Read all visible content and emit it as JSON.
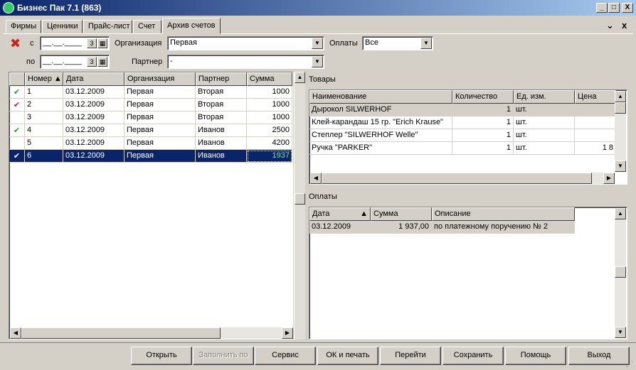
{
  "window": {
    "title": "Бизнес Пак 7.1 (863)",
    "min": "_",
    "max": "□",
    "close": "X",
    "menu_close": "x"
  },
  "tabs": [
    "Фирмы",
    "Ценники",
    "Прайс-лист",
    "Счет",
    "Архив счетов"
  ],
  "filters": {
    "from_label": "с",
    "to_label": "по",
    "date_placeholder": "__.__.____",
    "org_label": "Организация",
    "org_value": "Первая",
    "partner_label": "Партнер",
    "partner_value": "-",
    "payments_label": "Оплаты",
    "payments_value": "Все"
  },
  "invoices": {
    "columns": [
      "Номер",
      "Дата",
      "Организация",
      "Партнер",
      "Сумма"
    ],
    "rows": [
      {
        "mark": "✔",
        "mark_color": "green",
        "num": "1",
        "date": "03.12.2009",
        "org": "Первая",
        "partner": "Вторая",
        "sum": "1000"
      },
      {
        "mark": "✔",
        "mark_color": "red",
        "num": "2",
        "date": "03.12.2009",
        "org": "Первая",
        "partner": "Вторая",
        "sum": "1000"
      },
      {
        "mark": "",
        "mark_color": "",
        "num": "3",
        "date": "03.12.2009",
        "org": "Первая",
        "partner": "Вторая",
        "sum": "1000"
      },
      {
        "mark": "✔",
        "mark_color": "green",
        "num": "4",
        "date": "03.12.2009",
        "org": "Первая",
        "partner": "Иванов",
        "sum": "2500"
      },
      {
        "mark": "",
        "mark_color": "",
        "num": "5",
        "date": "03.12.2009",
        "org": "Первая",
        "partner": "Иванов",
        "sum": "4200"
      },
      {
        "mark": "✔",
        "mark_color": "green",
        "num": "6",
        "date": "03.12.2009",
        "org": "Первая",
        "partner": "Иванов",
        "sum": "1937"
      }
    ]
  },
  "goods": {
    "label": "Товары",
    "columns": [
      "Наименование",
      "Количество",
      "Ед. изм.",
      "Цена"
    ],
    "rows": [
      {
        "name": "Дырокол SILWERHOF",
        "qty": "1",
        "unit": "шт.",
        "price": ""
      },
      {
        "name": "Клей-карандаш 15 гр. \"Erich Krause\"",
        "qty": "1",
        "unit": "шт.",
        "price": ""
      },
      {
        "name": "Степлер \"SILWERHOF Welle\"",
        "qty": "1",
        "unit": "шт.",
        "price": ""
      },
      {
        "name": "Ручка \"PARKER\"",
        "qty": "1",
        "unit": "шт.",
        "price": "1 8"
      }
    ]
  },
  "payments": {
    "label": "Оплаты",
    "columns": [
      "Дата",
      "Сумма",
      "Описание"
    ],
    "rows": [
      {
        "date": "03.12.2009",
        "sum": "1 937,00",
        "desc": "по платежному поручению № 2"
      }
    ]
  },
  "buttons": {
    "open": "Открыть",
    "fill": "Заполнить по",
    "service": "Сервис",
    "ok_print": "ОК и печать",
    "go": "Перейти",
    "save": "Сохранить",
    "help": "Помощь",
    "exit": "Выход"
  },
  "colors": {
    "selection": "#0a246a",
    "check_green": "#22a022",
    "check_red": "#d21d1d"
  }
}
